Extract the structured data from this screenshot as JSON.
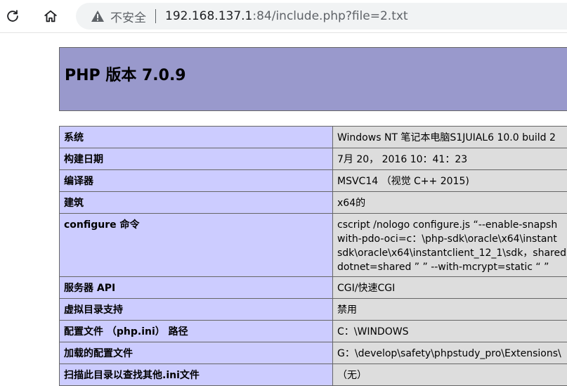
{
  "browser": {
    "security_label": "不安全",
    "url_host": "192.168.137.1",
    "url_rest": ":84/include.php?file=2.txt"
  },
  "phpinfo": {
    "title": "PHP 版本 7.0.9",
    "rows": [
      {
        "key": "系统",
        "value": [
          "Windows NT 笔记本电脑S1JUIAL6 10.0 build 2"
        ]
      },
      {
        "key": "构建日期",
        "value": [
          "7月 20， 2016 10：41：23"
        ]
      },
      {
        "key": "编译器",
        "value": [
          "MSVC14 （视觉 C++ 2015)"
        ]
      },
      {
        "key": "建筑",
        "value": [
          "x64的"
        ]
      },
      {
        "key": "configure 命令",
        "value": [
          "cscript /nologo configure.js “--enable-snapsh",
          "with-pdo-oci=c：\\php-sdk\\oracle\\x64\\instant",
          "sdk\\oracle\\x64\\instantclient_12_1\\sdk，shared",
          "dotnet=shared ” ” --with-mcrypt=static “ ”"
        ]
      },
      {
        "key": "服务器 API",
        "value": [
          "CGI/快速CGI"
        ]
      },
      {
        "key": "虚拟目录支持",
        "value": [
          "禁用"
        ]
      },
      {
        "key": "配置文件 （php.ini） 路径",
        "value": [
          "C：\\WINDOWS"
        ]
      },
      {
        "key": "加载的配置文件",
        "value": [
          "G：\\develop\\safety\\phpstudy_pro\\Extensions\\"
        ]
      },
      {
        "key": "扫描此目录以查找其他.ini文件",
        "value": [
          "（无）"
        ]
      }
    ]
  }
}
